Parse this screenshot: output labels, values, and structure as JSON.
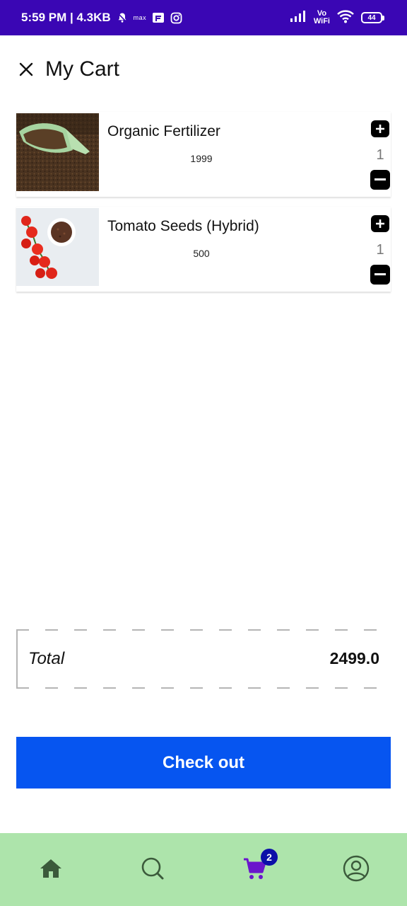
{
  "status_bar": {
    "time_data": "5:59 PM | 4.3KB",
    "max_label": "max",
    "vo_label": "Vo",
    "wifi_label": "WiFi",
    "battery": "44"
  },
  "header": {
    "title": "My Cart",
    "close_icon": "close-icon"
  },
  "cart": {
    "items": [
      {
        "name": "Organic Fertilizer",
        "price": "1999",
        "quantity": "1",
        "image": "fertilizer-soil-scoop"
      },
      {
        "name": "Tomato Seeds (Hybrid)",
        "price": "500",
        "quantity": "1",
        "image": "tomatoes-and-seeds-bowl"
      }
    ]
  },
  "total": {
    "label": "Total",
    "value": "2499.0"
  },
  "checkout": {
    "label": "Check out"
  },
  "bottom_nav": {
    "items": [
      {
        "icon": "home-icon",
        "active": false
      },
      {
        "icon": "search-icon",
        "active": false
      },
      {
        "icon": "cart-icon",
        "active": true
      },
      {
        "icon": "profile-icon",
        "active": false
      }
    ],
    "cart_badge": "2"
  },
  "colors": {
    "status_bar": "#3a06b4",
    "checkout_button": "#0655f0",
    "bottom_nav": "#ade4ab",
    "nav_active": "#6a16cc",
    "nav_inactive": "#3b5a3b",
    "badge": "#0c0fa8"
  }
}
